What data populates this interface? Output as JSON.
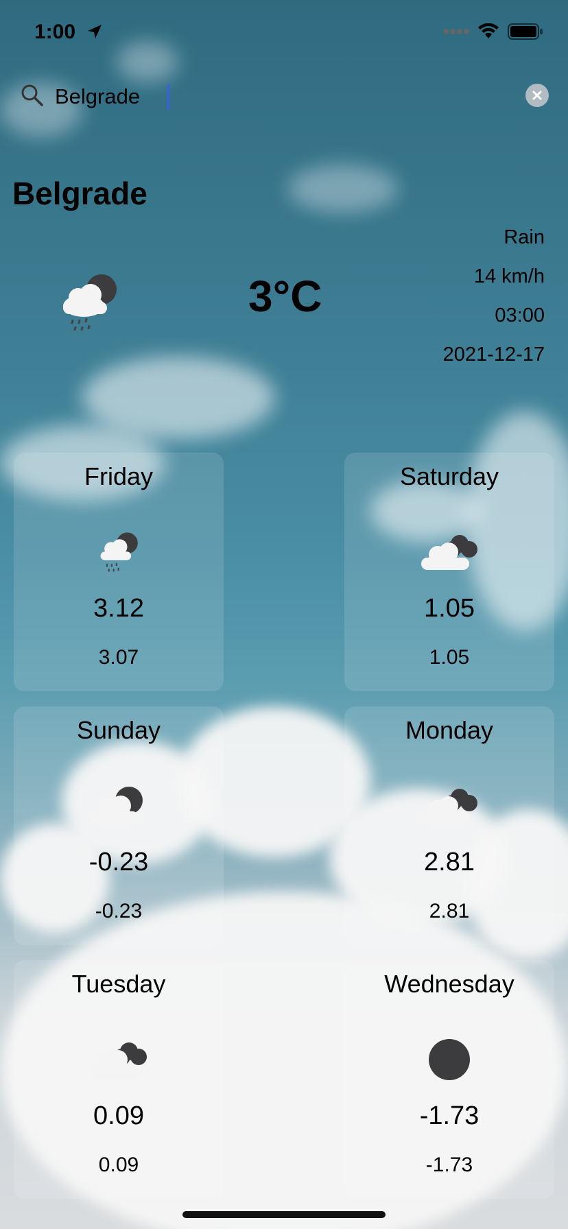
{
  "status_bar": {
    "time": "1:00"
  },
  "search": {
    "value": "Belgrade",
    "placeholder": ""
  },
  "current": {
    "city": "Belgrade",
    "temperature": "3°C",
    "condition": "Rain",
    "wind": "14 km/h",
    "time": "03:00",
    "date": "2021-12-17",
    "icon": "rain-cloud-icon"
  },
  "forecast": [
    {
      "day": "Friday",
      "temp": "3.12",
      "feels": "3.07",
      "icon": "rain-cloud-icon"
    },
    {
      "day": "Saturday",
      "temp": "1.05",
      "feels": "1.05",
      "icon": "broken-clouds-icon"
    },
    {
      "day": "Sunday",
      "temp": "-0.23",
      "feels": "-0.23",
      "icon": "cloud-dark-icon"
    },
    {
      "day": "Monday",
      "temp": "2.81",
      "feels": "2.81",
      "icon": "broken-clouds-icon"
    },
    {
      "day": "Tuesday",
      "temp": "0.09",
      "feels": "0.09",
      "icon": "broken-clouds-icon"
    },
    {
      "day": "Wednesday",
      "temp": "-1.73",
      "feels": "-1.73",
      "icon": "dark-disc-icon"
    }
  ]
}
